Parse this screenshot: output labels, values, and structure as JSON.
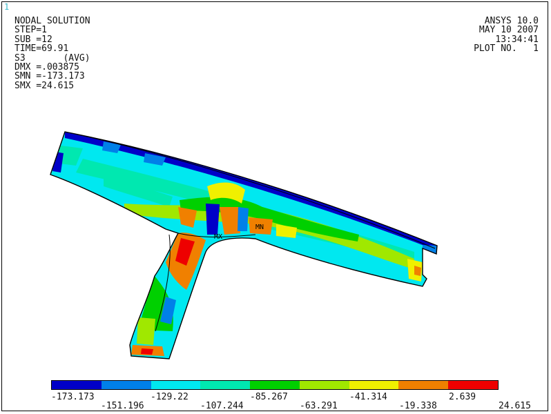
{
  "window_number": "1",
  "plot_info": {
    "lines": [
      "NODAL SOLUTION",
      "STEP=1",
      "SUB =12",
      "TIME=69.91",
      "S3       (AVG)",
      "DMX =.003875",
      "SMN =-173.173",
      "SMX =24.615"
    ]
  },
  "program_info": {
    "lines": [
      "ANSYS 10.0",
      "MAY 10 2007",
      "13:34:41",
      "PLOT NO.   1"
    ]
  },
  "markers": {
    "min_label": "MN",
    "max_label": "MX"
  },
  "legend": {
    "colors": [
      "#0000c8",
      "#0080e8",
      "#00e8f0",
      "#00e8b0",
      "#00d000",
      "#a0e800",
      "#f0f000",
      "#f08000",
      "#ee0000"
    ],
    "labels": [
      "-173.173",
      "-151.196",
      "-129.22",
      "-107.244",
      "-85.267",
      "-63.291",
      "-41.314",
      "-19.338",
      "2.639",
      "24.615"
    ]
  }
}
